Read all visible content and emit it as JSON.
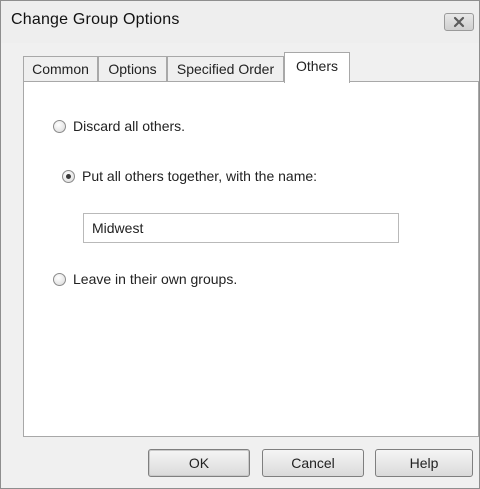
{
  "window": {
    "title": "Change Group Options",
    "close_icon": "close-x-icon"
  },
  "tabs": [
    {
      "label": "Common",
      "active": false
    },
    {
      "label": "Options",
      "active": false
    },
    {
      "label": "Specified Order",
      "active": false
    },
    {
      "label": "Others",
      "active": true
    }
  ],
  "others": {
    "options": [
      {
        "label": "Discard all others.",
        "checked": false
      },
      {
        "label": "Put all others together, with the name:",
        "checked": true
      },
      {
        "label": "Leave in their own groups.",
        "checked": false
      }
    ],
    "group_name_value": "Midwest"
  },
  "buttons": {
    "ok": "OK",
    "cancel": "Cancel",
    "help": "Help"
  }
}
